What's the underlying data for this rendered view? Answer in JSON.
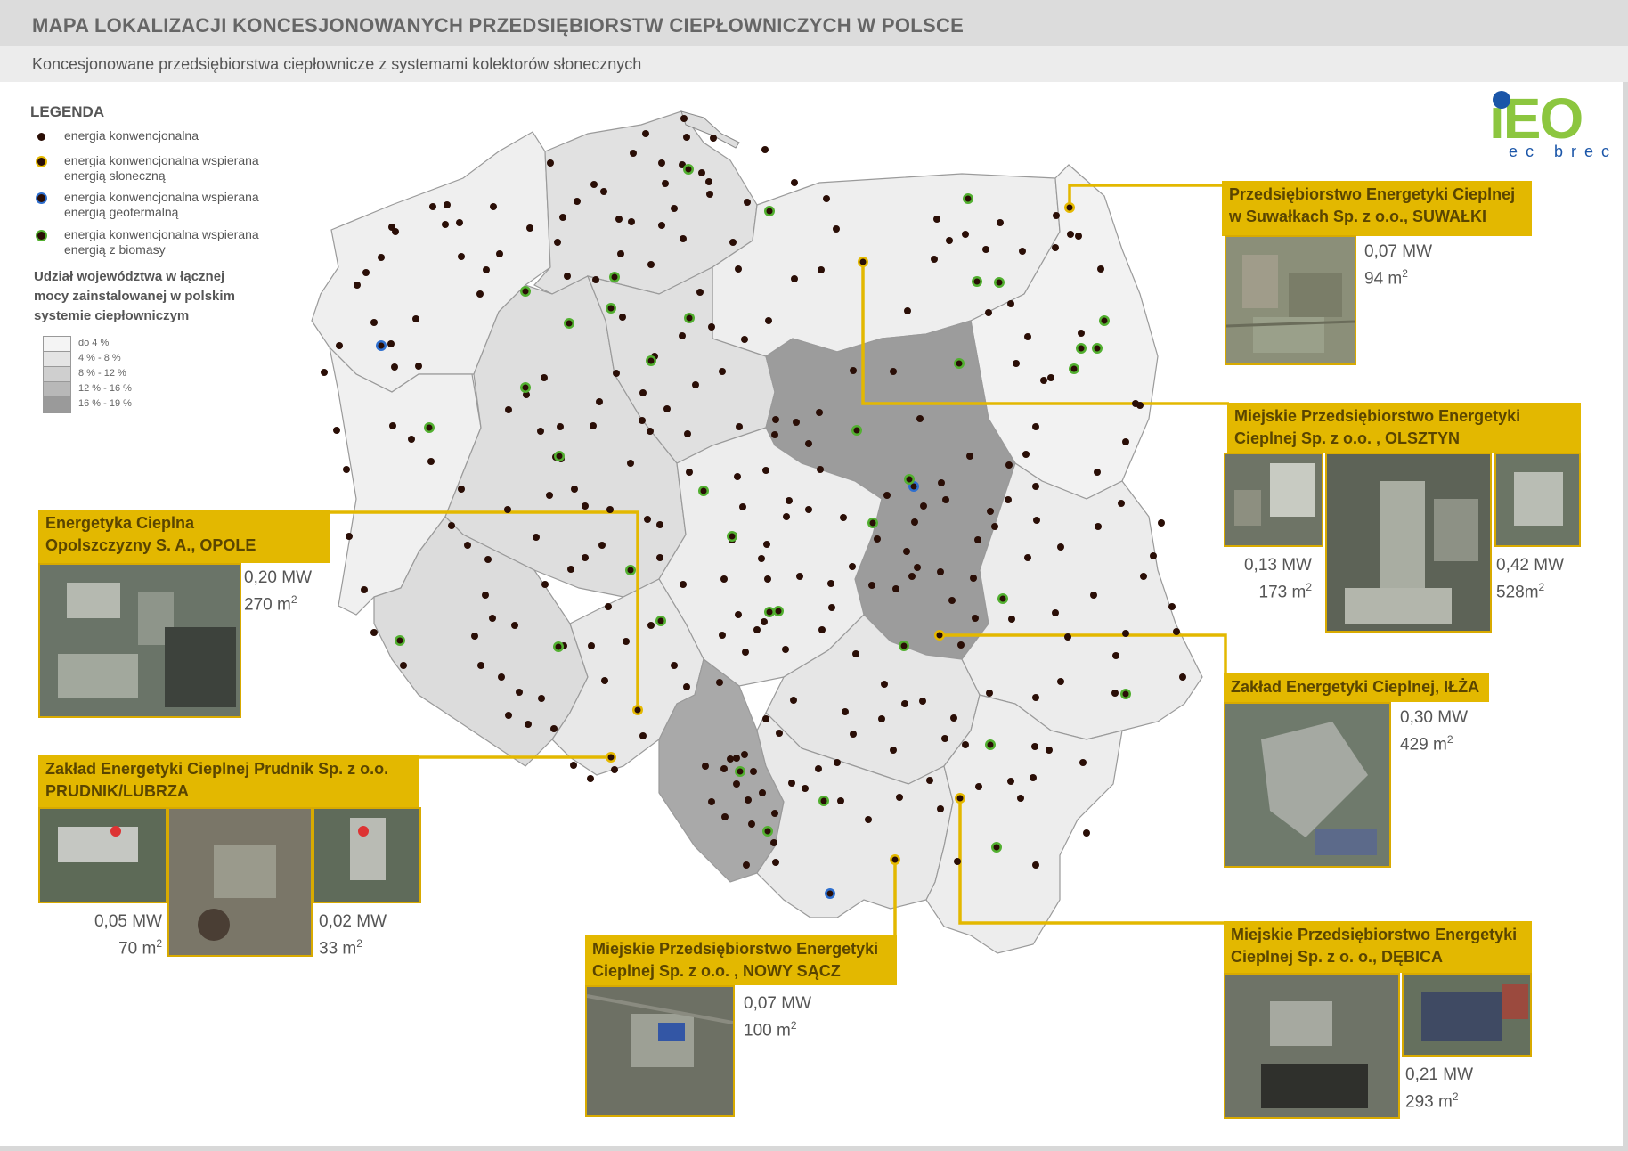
{
  "title": "MAPA LOKALIZACJI KONCESJONOWANYCH PRZEDSIĘBIORSTW CIEPŁOWNICZYCH W POLSCE",
  "subtitle": "Koncesjonowane przedsiębiorstwa ciepłownicze z systemami kolektorów słonecznych",
  "legend": {
    "title": "LEGENDA",
    "items": [
      {
        "type": "conventional",
        "label": "energia konwencjonalna"
      },
      {
        "type": "solar",
        "label": "energia konwencjonalna wspierana energią słoneczną"
      },
      {
        "type": "geo",
        "label": "energia konwencjonalna wspierana energią geotermalną"
      },
      {
        "type": "bio",
        "label": "energia konwencjonalna wspierana energią z biomasy"
      }
    ],
    "share_title": "Udział województwa w łącznej mocy zainstalowanej w polskim systemie ciepłowniczym",
    "scale": [
      {
        "label": "do 4 %",
        "color": "#f4f4f4"
      },
      {
        "label": "4 % - 8 %",
        "color": "#e4e4e4"
      },
      {
        "label": "8 % - 12 %",
        "color": "#cfcfcf"
      },
      {
        "label": "12 % - 16 %",
        "color": "#b8b8b8"
      },
      {
        "label": "16 % - 19 %",
        "color": "#9a9a9a"
      }
    ]
  },
  "logo": {
    "main": "iEO",
    "sub": "ec brec"
  },
  "colors": {
    "callout": "#e3b800",
    "solar": "#e5b900",
    "geo": "#2e6fcf",
    "bio": "#52b030",
    "dot": "#2a0e06"
  },
  "callouts": {
    "suwalki": {
      "name_1": "Przedsiębiorstwo Energetyki Cieplnej",
      "name_2": "w Suwałkach Sp. z o.o., SUWAŁKI",
      "power": "0,07 MW",
      "area": "94 m",
      "area_exp": "2"
    },
    "olsztyn": {
      "name_1": "Miejskie Przedsiębiorstwo Energetyki",
      "name_2": "Cieplnej Sp. z o.o. , OLSZTYN",
      "power_a": "0,13 MW",
      "area_a": "173 m",
      "area_a_exp": "2",
      "power_b": "0,42 MW",
      "area_b": "528m",
      "area_b_exp": "2"
    },
    "opole": {
      "name_1": "Energetyka Cieplna",
      "name_2": "Opolszczyzny S. A., OPOLE",
      "power": "0,20 MW",
      "area": "270 m",
      "area_exp": "2"
    },
    "ilza": {
      "name_1": "Zakład Energetyki Cieplnej, IŁŻA",
      "power": "0,30 MW",
      "area": "429 m",
      "area_exp": "2"
    },
    "prudnik": {
      "name_1": "Zakład Energetyki Cieplnej Prudnik  Sp. z o.o.",
      "name_2": "PRUDNIK/LUBRZA",
      "power_a": "0,05 MW",
      "area_a": "70 m",
      "area_a_exp": "2",
      "power_b": "0,02 MW",
      "area_b": "33 m",
      "area_b_exp": "2"
    },
    "nowy_sacz": {
      "name_1": "Miejskie Przedsiębiorstwo Energetyki",
      "name_2": "Cieplnej Sp. z o.o. , NOWY SĄCZ",
      "power": "0,07 MW",
      "area": "100 m",
      "area_exp": "2"
    },
    "debica": {
      "name_1": "Miejskie Przedsiębiorstwo Energetyki",
      "name_2": "Cieplnej Sp. z o. o., DĘBICA",
      "power": "0,21 MW",
      "area": "293 m",
      "area_exp": "2"
    }
  }
}
